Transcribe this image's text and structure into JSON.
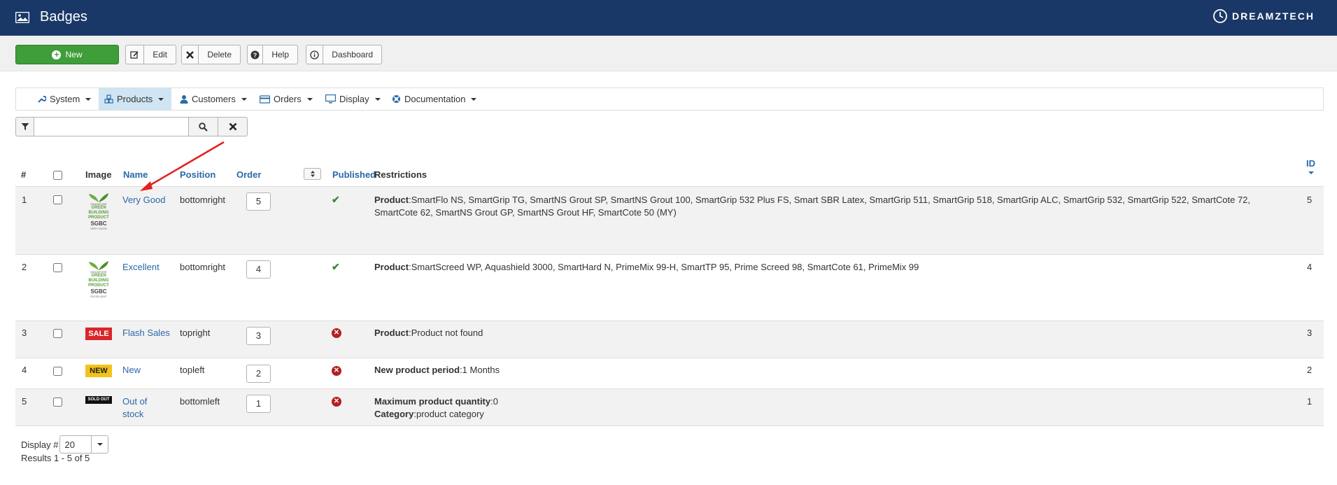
{
  "header": {
    "title": "Badges",
    "brand": "DREAMZTECH"
  },
  "toolbar": {
    "new_label": "New",
    "edit_label": "Edit",
    "delete_label": "Delete",
    "help_label": "Help",
    "dashboard_label": "Dashboard"
  },
  "menu": {
    "items": [
      {
        "label": "System",
        "icon": "wrench-icon"
      },
      {
        "label": "Products",
        "icon": "cubes-icon",
        "active": true
      },
      {
        "label": "Customers",
        "icon": "user-icon"
      },
      {
        "label": "Orders",
        "icon": "credit-card-icon"
      },
      {
        "label": "Display",
        "icon": "monitor-icon"
      },
      {
        "label": "Documentation",
        "icon": "lifebuoy-icon"
      }
    ]
  },
  "filter": {
    "value": "",
    "placeholder": ""
  },
  "table": {
    "columns": {
      "num": "#",
      "image": "Image",
      "name": "Name",
      "position": "Position",
      "order": "Order",
      "published": "Published",
      "restrictions": "Restrictions",
      "id": "ID"
    },
    "rows": [
      {
        "num": "1",
        "badge": "green-very-good",
        "name": "Very Good",
        "position": "bottomright",
        "order": "5",
        "published": true,
        "restr_label": "Product",
        "restr_value": ":SmartFlo NS, SmartGrip TG, SmartNS Grout SP, SmartNS Grout 100, SmartGrip 532 Plus FS, Smart SBR Latex, SmartGrip 511, SmartGrip 518, SmartGrip ALC, SmartGrip 532, SmartGrip 522, SmartCote 72, SmartCote 62, SmartNS Grout GP, SmartNS Grout HF, SmartCote 50 (MY)",
        "id": "5"
      },
      {
        "num": "2",
        "badge": "green-excellent",
        "name": "Excellent",
        "position": "bottomright",
        "order": "4",
        "published": true,
        "restr_label": "Product",
        "restr_value": ":SmartScreed WP, Aquashield 3000, SmartHard N, PrimeMix 99-H, SmartTP 95, Prime Screed 98, SmartCote 61, PrimeMix 99",
        "id": "4"
      },
      {
        "num": "3",
        "badge": "SALE",
        "name": "Flash Sales",
        "position": "topright",
        "order": "3",
        "published": false,
        "restr_label": "Product",
        "restr_value": ":Product not found",
        "id": "3"
      },
      {
        "num": "4",
        "badge": "NEW",
        "name": "New",
        "position": "topleft",
        "order": "2",
        "published": false,
        "restr_label": "New product period",
        "restr_value": ":1 Months",
        "id": "2"
      },
      {
        "num": "5",
        "badge": "SOLD OUT",
        "name": "Out of stock",
        "position": "bottomleft",
        "order": "1",
        "published": false,
        "restr_label": "Maximum product quantity",
        "restr_value": ":0",
        "restr_label2": "Category",
        "restr_value2": ":product category",
        "id": "1"
      }
    ]
  },
  "badges": {
    "green_t1": "SINGAPORE",
    "green_t2a": "GREEN",
    "green_t2b": "BUILDING",
    "green_t2c": "PRODUCT",
    "green_t3": "SGBC",
    "green_t4a": "VERY GOOD",
    "green_t4b": "EXCELLENT"
  },
  "footer": {
    "display_label": "Display #",
    "display_value": "20",
    "results": "Results 1 - 5 of 5"
  },
  "colors": {
    "header_bg": "#1a3867",
    "new_button": "#3f9d3a",
    "link": "#2a69a8",
    "annotation_arrow": "#e32020"
  }
}
